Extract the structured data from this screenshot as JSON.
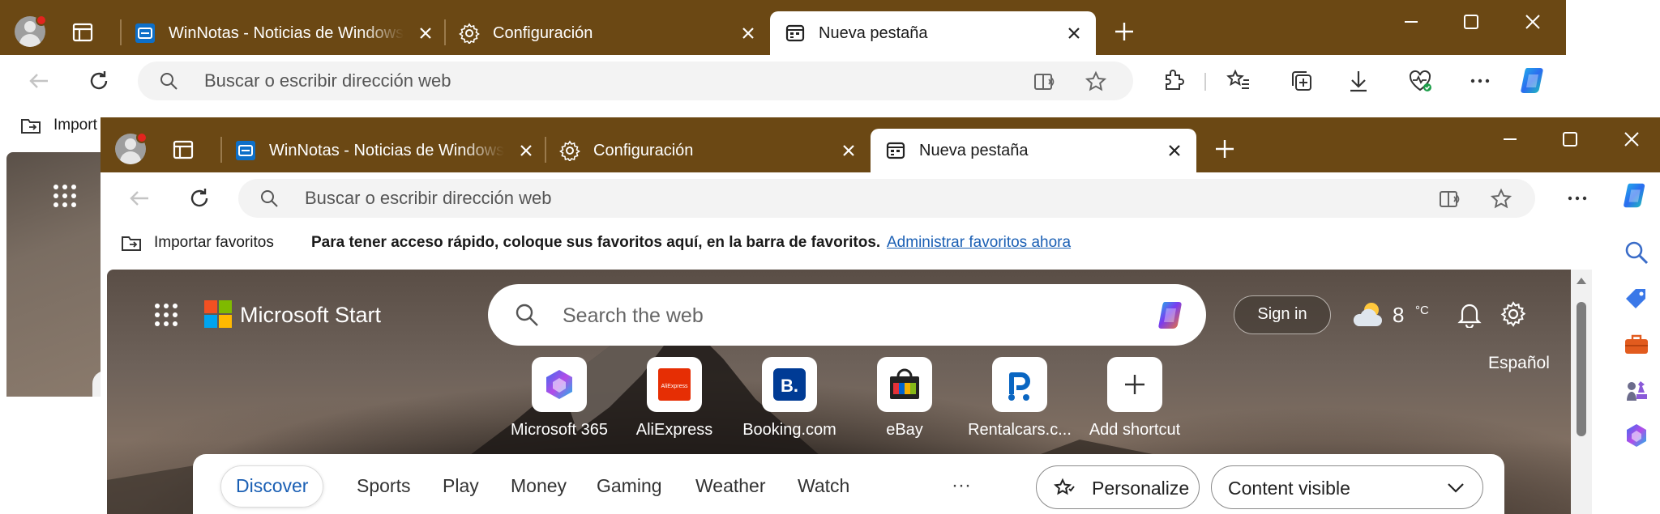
{
  "back_window": {
    "tabs": [
      {
        "label": "WinNotas - Noticias de Windows",
        "icon": "winnotas-favicon"
      },
      {
        "label": "Configuración",
        "icon": "gear-icon"
      },
      {
        "label": "Nueva pestaña",
        "icon": "new-tab-page-icon",
        "active": true
      }
    ],
    "address_placeholder": "Buscar o escribir dirección web",
    "favbar_import_label": "Import"
  },
  "front_window": {
    "tabs": [
      {
        "label": "WinNotas - Noticias de Windows",
        "icon": "winnotas-favicon"
      },
      {
        "label": "Configuración",
        "icon": "gear-icon"
      },
      {
        "label": "Nueva pestaña",
        "icon": "new-tab-page-icon",
        "active": true
      }
    ],
    "address_placeholder": "Buscar o escribir dirección web",
    "favbar": {
      "import_label": "Importar favoritos",
      "hint": "Para tener acceso rápido, coloque sus favoritos aquí, en la barra de favoritos.",
      "manage_link": "Administrar favoritos ahora"
    }
  },
  "newtab": {
    "brand": "Microsoft Start",
    "search_placeholder": "Search the web",
    "sign_in": "Sign in",
    "weather": {
      "temp": "8",
      "unit": "°C",
      "icon": "partly-cloudy-icon"
    },
    "language": "Español",
    "shortcuts": [
      {
        "label": "Microsoft 365",
        "icon": "microsoft-365-icon"
      },
      {
        "label": "AliExpress",
        "icon": "aliexpress-icon",
        "tile_text": "AliExpress"
      },
      {
        "label": "Booking.com",
        "icon": "booking-icon",
        "tile_text": "B."
      },
      {
        "label": "eBay",
        "icon": "ebay-icon"
      },
      {
        "label": "Rentalcars.c...",
        "icon": "rentalcars-icon"
      },
      {
        "label": "Add shortcut",
        "icon": "plus-icon"
      }
    ],
    "nav_tabs": [
      "Discover",
      "Sports",
      "Play",
      "Money",
      "Gaming",
      "Weather",
      "Watch"
    ],
    "active_nav": "Discover",
    "more": "···",
    "personalize": "Personalize",
    "content_visibility": "Content visible"
  },
  "colors": {
    "titlebar": "#6b4814",
    "link": "#1a5fb4",
    "omnibox": "#f3f3f3"
  }
}
